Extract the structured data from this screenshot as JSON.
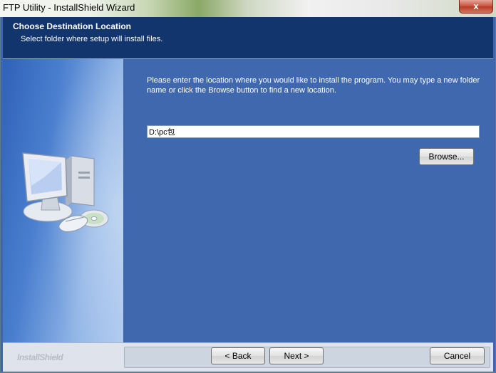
{
  "window": {
    "title": "FTP Utility - InstallShield Wizard",
    "close_symbol": "x"
  },
  "header": {
    "title": "Choose Destination Location",
    "subtitle": "Select folder where setup will install files."
  },
  "main": {
    "instructions": "Please enter the location where you would like to install the program.  You may type a new folder name or click the Browse button to find a new location.",
    "path_value": "D:\\pc包",
    "browse_label": "Browse..."
  },
  "footer": {
    "brand": "InstallShield",
    "back_label": "< Back",
    "next_label": "Next >",
    "cancel_label": "Cancel"
  },
  "icons": [
    "computer-icon",
    "cd-icon",
    "mouse-icon",
    "close-icon"
  ]
}
